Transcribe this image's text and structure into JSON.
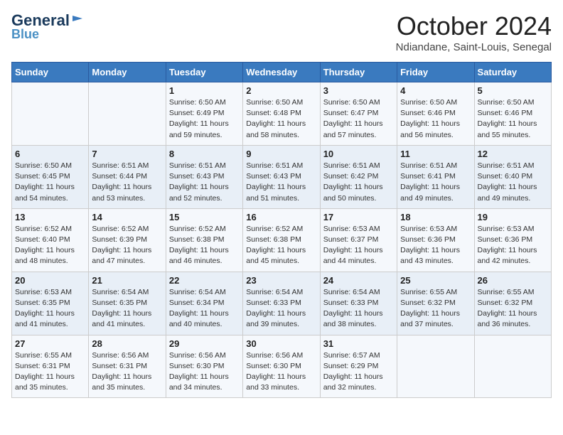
{
  "header": {
    "logo_general": "General",
    "logo_blue": "Blue",
    "month_title": "October 2024",
    "location": "Ndiandane, Saint-Louis, Senegal"
  },
  "days_of_week": [
    "Sunday",
    "Monday",
    "Tuesday",
    "Wednesday",
    "Thursday",
    "Friday",
    "Saturday"
  ],
  "weeks": [
    [
      {
        "day": "",
        "info": ""
      },
      {
        "day": "",
        "info": ""
      },
      {
        "day": "1",
        "info": "Sunrise: 6:50 AM\nSunset: 6:49 PM\nDaylight: 11 hours and 59 minutes."
      },
      {
        "day": "2",
        "info": "Sunrise: 6:50 AM\nSunset: 6:48 PM\nDaylight: 11 hours and 58 minutes."
      },
      {
        "day": "3",
        "info": "Sunrise: 6:50 AM\nSunset: 6:47 PM\nDaylight: 11 hours and 57 minutes."
      },
      {
        "day": "4",
        "info": "Sunrise: 6:50 AM\nSunset: 6:46 PM\nDaylight: 11 hours and 56 minutes."
      },
      {
        "day": "5",
        "info": "Sunrise: 6:50 AM\nSunset: 6:46 PM\nDaylight: 11 hours and 55 minutes."
      }
    ],
    [
      {
        "day": "6",
        "info": "Sunrise: 6:50 AM\nSunset: 6:45 PM\nDaylight: 11 hours and 54 minutes."
      },
      {
        "day": "7",
        "info": "Sunrise: 6:51 AM\nSunset: 6:44 PM\nDaylight: 11 hours and 53 minutes."
      },
      {
        "day": "8",
        "info": "Sunrise: 6:51 AM\nSunset: 6:43 PM\nDaylight: 11 hours and 52 minutes."
      },
      {
        "day": "9",
        "info": "Sunrise: 6:51 AM\nSunset: 6:43 PM\nDaylight: 11 hours and 51 minutes."
      },
      {
        "day": "10",
        "info": "Sunrise: 6:51 AM\nSunset: 6:42 PM\nDaylight: 11 hours and 50 minutes."
      },
      {
        "day": "11",
        "info": "Sunrise: 6:51 AM\nSunset: 6:41 PM\nDaylight: 11 hours and 49 minutes."
      },
      {
        "day": "12",
        "info": "Sunrise: 6:51 AM\nSunset: 6:40 PM\nDaylight: 11 hours and 49 minutes."
      }
    ],
    [
      {
        "day": "13",
        "info": "Sunrise: 6:52 AM\nSunset: 6:40 PM\nDaylight: 11 hours and 48 minutes."
      },
      {
        "day": "14",
        "info": "Sunrise: 6:52 AM\nSunset: 6:39 PM\nDaylight: 11 hours and 47 minutes."
      },
      {
        "day": "15",
        "info": "Sunrise: 6:52 AM\nSunset: 6:38 PM\nDaylight: 11 hours and 46 minutes."
      },
      {
        "day": "16",
        "info": "Sunrise: 6:52 AM\nSunset: 6:38 PM\nDaylight: 11 hours and 45 minutes."
      },
      {
        "day": "17",
        "info": "Sunrise: 6:53 AM\nSunset: 6:37 PM\nDaylight: 11 hours and 44 minutes."
      },
      {
        "day": "18",
        "info": "Sunrise: 6:53 AM\nSunset: 6:36 PM\nDaylight: 11 hours and 43 minutes."
      },
      {
        "day": "19",
        "info": "Sunrise: 6:53 AM\nSunset: 6:36 PM\nDaylight: 11 hours and 42 minutes."
      }
    ],
    [
      {
        "day": "20",
        "info": "Sunrise: 6:53 AM\nSunset: 6:35 PM\nDaylight: 11 hours and 41 minutes."
      },
      {
        "day": "21",
        "info": "Sunrise: 6:54 AM\nSunset: 6:35 PM\nDaylight: 11 hours and 41 minutes."
      },
      {
        "day": "22",
        "info": "Sunrise: 6:54 AM\nSunset: 6:34 PM\nDaylight: 11 hours and 40 minutes."
      },
      {
        "day": "23",
        "info": "Sunrise: 6:54 AM\nSunset: 6:33 PM\nDaylight: 11 hours and 39 minutes."
      },
      {
        "day": "24",
        "info": "Sunrise: 6:54 AM\nSunset: 6:33 PM\nDaylight: 11 hours and 38 minutes."
      },
      {
        "day": "25",
        "info": "Sunrise: 6:55 AM\nSunset: 6:32 PM\nDaylight: 11 hours and 37 minutes."
      },
      {
        "day": "26",
        "info": "Sunrise: 6:55 AM\nSunset: 6:32 PM\nDaylight: 11 hours and 36 minutes."
      }
    ],
    [
      {
        "day": "27",
        "info": "Sunrise: 6:55 AM\nSunset: 6:31 PM\nDaylight: 11 hours and 35 minutes."
      },
      {
        "day": "28",
        "info": "Sunrise: 6:56 AM\nSunset: 6:31 PM\nDaylight: 11 hours and 35 minutes."
      },
      {
        "day": "29",
        "info": "Sunrise: 6:56 AM\nSunset: 6:30 PM\nDaylight: 11 hours and 34 minutes."
      },
      {
        "day": "30",
        "info": "Sunrise: 6:56 AM\nSunset: 6:30 PM\nDaylight: 11 hours and 33 minutes."
      },
      {
        "day": "31",
        "info": "Sunrise: 6:57 AM\nSunset: 6:29 PM\nDaylight: 11 hours and 32 minutes."
      },
      {
        "day": "",
        "info": ""
      },
      {
        "day": "",
        "info": ""
      }
    ]
  ]
}
